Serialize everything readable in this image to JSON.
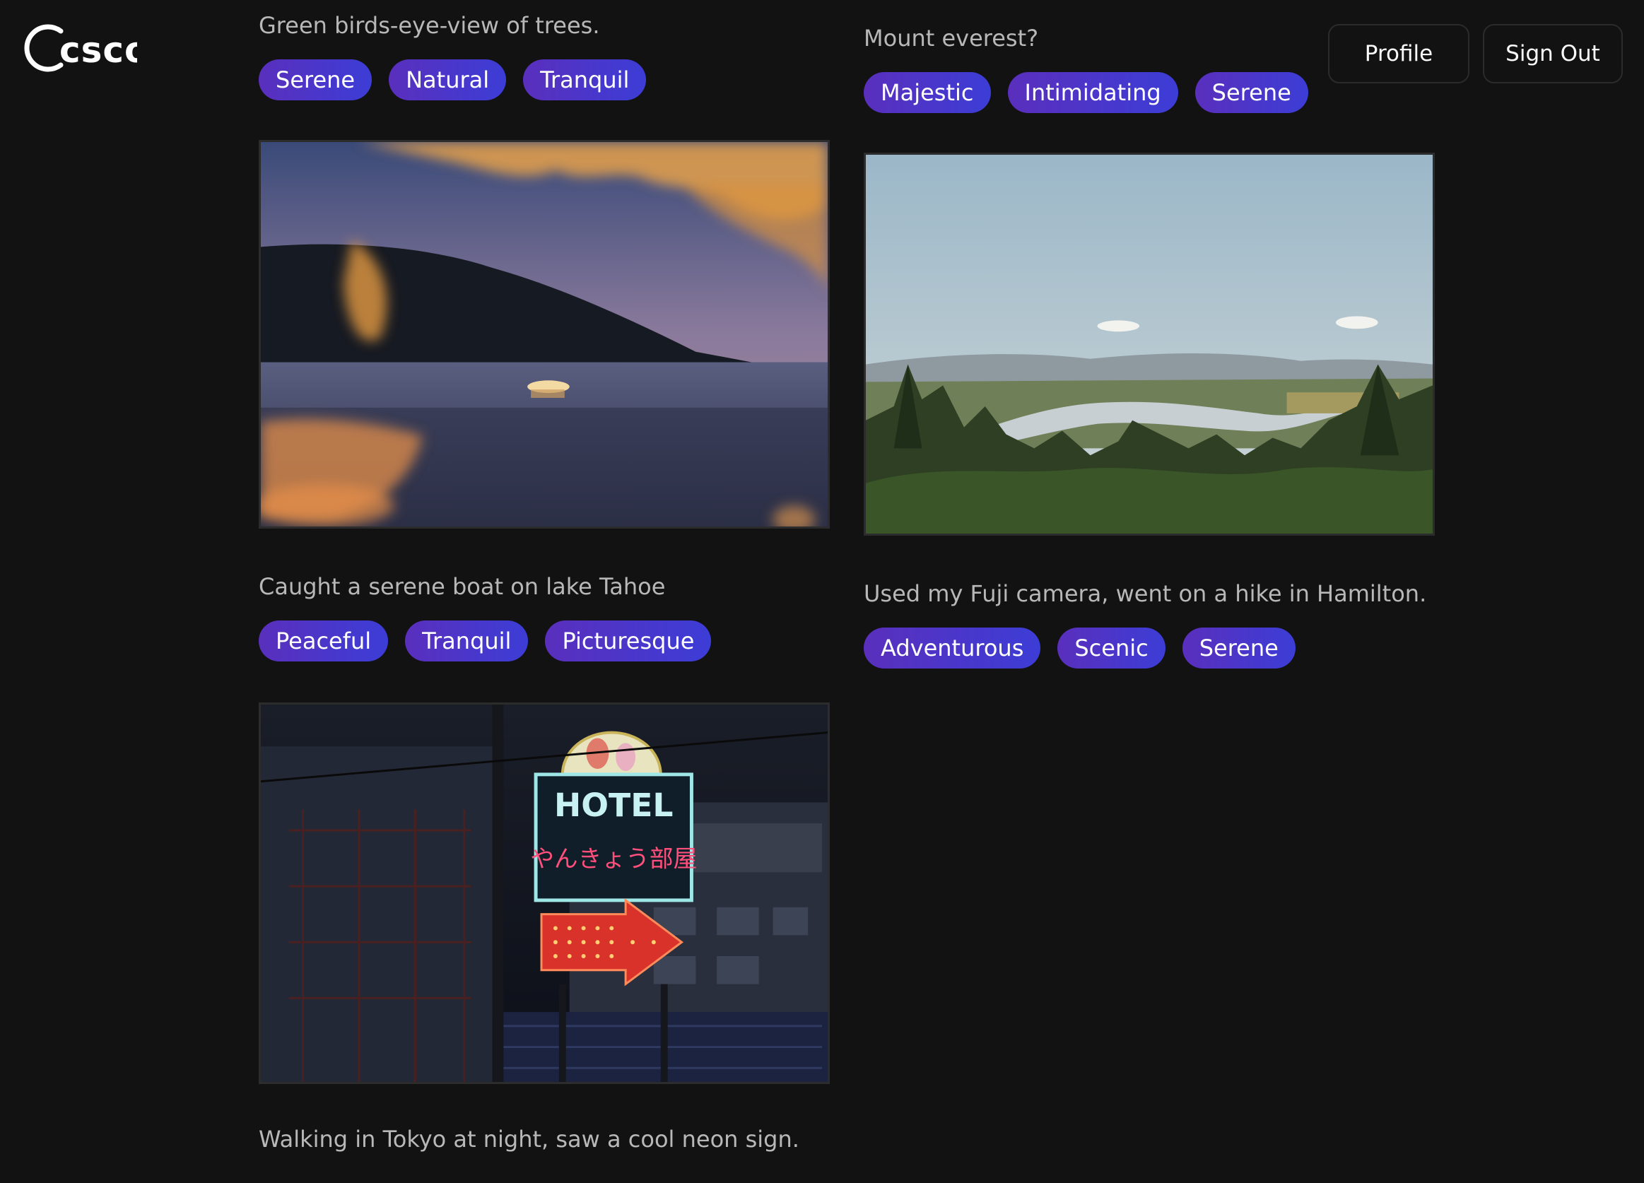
{
  "app": {
    "logo_text": "csco"
  },
  "header": {
    "profile_label": "Profile",
    "signout_label": "Sign Out"
  },
  "posts_left": [
    {
      "caption": "Green birds-eye-view of trees.",
      "tags": [
        "Serene",
        "Natural",
        "Tranquil"
      ]
    },
    {
      "caption": "Caught a serene boat on lake Tahoe",
      "tags": [
        "Peaceful",
        "Tranquil",
        "Picturesque"
      ]
    },
    {
      "caption": "Walking in Tokyo at night, saw a cool neon sign.",
      "tags": []
    }
  ],
  "posts_right": [
    {
      "caption": "Mount everest?",
      "tags": [
        "Majestic",
        "Intimidating",
        "Serene"
      ]
    },
    {
      "caption": "Used my Fuji camera, went on a hike in Hamilton.",
      "tags": [
        "Adventurous",
        "Scenic",
        "Serene"
      ]
    }
  ],
  "neon_sign": {
    "line1": "HOTEL",
    "line2": "やんきょう部屋"
  },
  "colors": {
    "tag_start": "#5a2fbd",
    "tag_end": "#3c3dd6",
    "background": "#121212"
  }
}
